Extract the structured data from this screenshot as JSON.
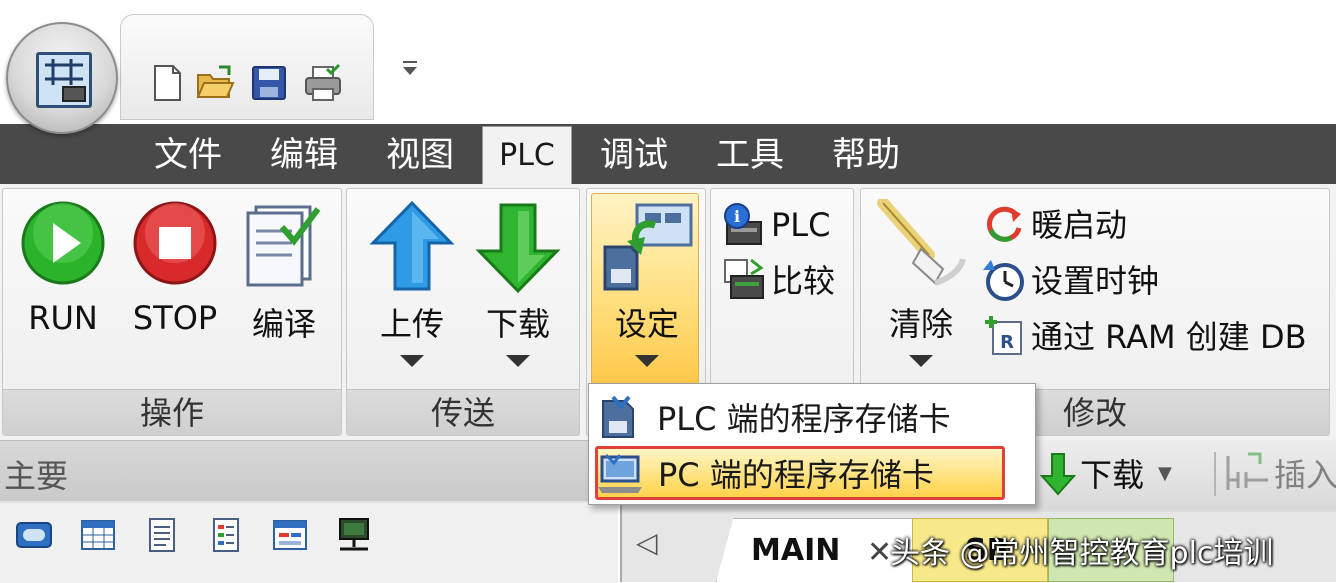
{
  "menu": {
    "items": [
      {
        "label": "文件"
      },
      {
        "label": "编辑"
      },
      {
        "label": "视图"
      },
      {
        "label": "PLC"
      },
      {
        "label": "调试"
      },
      {
        "label": "工具"
      },
      {
        "label": "帮助"
      }
    ]
  },
  "ribbon": {
    "operate": {
      "group_label": "操作",
      "run": "RUN",
      "stop": "STOP",
      "compile": "编译"
    },
    "transfer": {
      "group_label": "传送",
      "upload": "上传",
      "download": "下载"
    },
    "memory": {
      "setup": "设定"
    },
    "info": {
      "plc": "PLC",
      "compare": "比较"
    },
    "modify": {
      "group_label": "修改",
      "clear": "清除",
      "warm_start": "暖启动",
      "set_clock": "设置时钟",
      "create_db": "通过 RAM 创建 DB"
    }
  },
  "dropdown": {
    "items": [
      {
        "label": "PLC 端的程序存储卡"
      },
      {
        "label": "PC 端的程序存储卡"
      }
    ]
  },
  "left_panel": {
    "title": "主要"
  },
  "right_toolbar": {
    "download": "下载",
    "insert": "插入"
  },
  "tabs": {
    "main": "MAIN",
    "close": "✕",
    "second_partial": "SB"
  },
  "watermark": "头条 @常州智控教育plc培训",
  "colors": {
    "menubar": "#494949",
    "highlight_border": "#e0413a",
    "highlight_fill": "#ffe07a"
  }
}
